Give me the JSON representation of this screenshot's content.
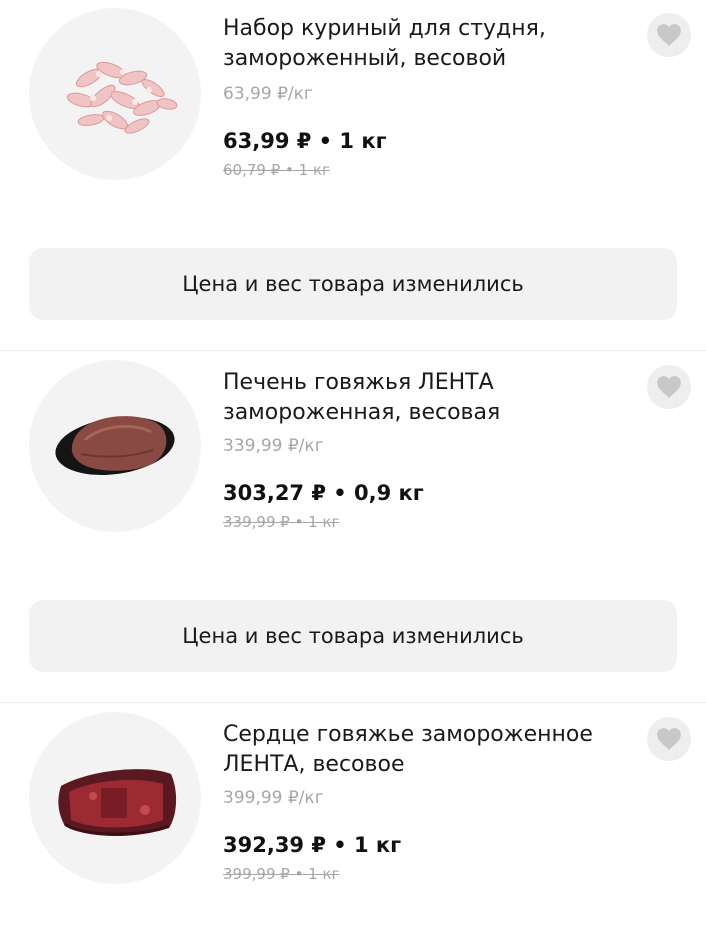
{
  "products": [
    {
      "title": "Набор куриный для студня,\nзамороженный, весовой",
      "unit_price": "63,99 ₽/кг",
      "price": "63,99 ₽ • 1 кг",
      "old_price": "60,79 ₽ • 1 кг",
      "image": "chicken-feet-image",
      "notice": "Цена и вес товара изменились"
    },
    {
      "title": "Печень говяжья ЛЕНТА\nзамороженная, весовая",
      "unit_price": "339,99 ₽/кг",
      "price": "303,27 ₽ • 0,9 кг",
      "old_price": "339,99 ₽ • 1 кг",
      "image": "beef-liver-image",
      "notice": "Цена и вес товара изменились"
    },
    {
      "title": "Сердце говяжье замороженное\nЛЕНТА, весовое",
      "unit_price": "399,99 ₽/кг",
      "price": "392,39 ₽ • 1 кг",
      "old_price": "399,99 ₽ • 1 кг",
      "image": "beef-heart-image"
    }
  ],
  "icons": {
    "favorite": "heart-icon"
  },
  "colors": {
    "text": "#1a1a1a",
    "muted": "#a6a6a6",
    "notice_bg": "#f2f2f2",
    "thumb_bg": "#f3f3f3",
    "heart": "#c8c8c8"
  }
}
